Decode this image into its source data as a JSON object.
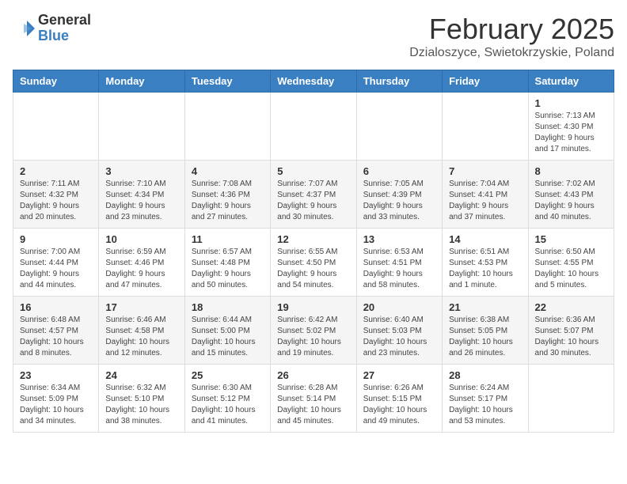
{
  "header": {
    "logo": {
      "general": "General",
      "blue": "Blue"
    },
    "title": "February 2025",
    "subtitle": "Dzialoszyce, Swietokrzyskie, Poland"
  },
  "weekdays": [
    "Sunday",
    "Monday",
    "Tuesday",
    "Wednesday",
    "Thursday",
    "Friday",
    "Saturday"
  ],
  "weeks": [
    [
      {
        "day": "",
        "info": ""
      },
      {
        "day": "",
        "info": ""
      },
      {
        "day": "",
        "info": ""
      },
      {
        "day": "",
        "info": ""
      },
      {
        "day": "",
        "info": ""
      },
      {
        "day": "",
        "info": ""
      },
      {
        "day": "1",
        "info": "Sunrise: 7:13 AM\nSunset: 4:30 PM\nDaylight: 9 hours and 17 minutes."
      }
    ],
    [
      {
        "day": "2",
        "info": "Sunrise: 7:11 AM\nSunset: 4:32 PM\nDaylight: 9 hours and 20 minutes."
      },
      {
        "day": "3",
        "info": "Sunrise: 7:10 AM\nSunset: 4:34 PM\nDaylight: 9 hours and 23 minutes."
      },
      {
        "day": "4",
        "info": "Sunrise: 7:08 AM\nSunset: 4:36 PM\nDaylight: 9 hours and 27 minutes."
      },
      {
        "day": "5",
        "info": "Sunrise: 7:07 AM\nSunset: 4:37 PM\nDaylight: 9 hours and 30 minutes."
      },
      {
        "day": "6",
        "info": "Sunrise: 7:05 AM\nSunset: 4:39 PM\nDaylight: 9 hours and 33 minutes."
      },
      {
        "day": "7",
        "info": "Sunrise: 7:04 AM\nSunset: 4:41 PM\nDaylight: 9 hours and 37 minutes."
      },
      {
        "day": "8",
        "info": "Sunrise: 7:02 AM\nSunset: 4:43 PM\nDaylight: 9 hours and 40 minutes."
      }
    ],
    [
      {
        "day": "9",
        "info": "Sunrise: 7:00 AM\nSunset: 4:44 PM\nDaylight: 9 hours and 44 minutes."
      },
      {
        "day": "10",
        "info": "Sunrise: 6:59 AM\nSunset: 4:46 PM\nDaylight: 9 hours and 47 minutes."
      },
      {
        "day": "11",
        "info": "Sunrise: 6:57 AM\nSunset: 4:48 PM\nDaylight: 9 hours and 50 minutes."
      },
      {
        "day": "12",
        "info": "Sunrise: 6:55 AM\nSunset: 4:50 PM\nDaylight: 9 hours and 54 minutes."
      },
      {
        "day": "13",
        "info": "Sunrise: 6:53 AM\nSunset: 4:51 PM\nDaylight: 9 hours and 58 minutes."
      },
      {
        "day": "14",
        "info": "Sunrise: 6:51 AM\nSunset: 4:53 PM\nDaylight: 10 hours and 1 minute."
      },
      {
        "day": "15",
        "info": "Sunrise: 6:50 AM\nSunset: 4:55 PM\nDaylight: 10 hours and 5 minutes."
      }
    ],
    [
      {
        "day": "16",
        "info": "Sunrise: 6:48 AM\nSunset: 4:57 PM\nDaylight: 10 hours and 8 minutes."
      },
      {
        "day": "17",
        "info": "Sunrise: 6:46 AM\nSunset: 4:58 PM\nDaylight: 10 hours and 12 minutes."
      },
      {
        "day": "18",
        "info": "Sunrise: 6:44 AM\nSunset: 5:00 PM\nDaylight: 10 hours and 15 minutes."
      },
      {
        "day": "19",
        "info": "Sunrise: 6:42 AM\nSunset: 5:02 PM\nDaylight: 10 hours and 19 minutes."
      },
      {
        "day": "20",
        "info": "Sunrise: 6:40 AM\nSunset: 5:03 PM\nDaylight: 10 hours and 23 minutes."
      },
      {
        "day": "21",
        "info": "Sunrise: 6:38 AM\nSunset: 5:05 PM\nDaylight: 10 hours and 26 minutes."
      },
      {
        "day": "22",
        "info": "Sunrise: 6:36 AM\nSunset: 5:07 PM\nDaylight: 10 hours and 30 minutes."
      }
    ],
    [
      {
        "day": "23",
        "info": "Sunrise: 6:34 AM\nSunset: 5:09 PM\nDaylight: 10 hours and 34 minutes."
      },
      {
        "day": "24",
        "info": "Sunrise: 6:32 AM\nSunset: 5:10 PM\nDaylight: 10 hours and 38 minutes."
      },
      {
        "day": "25",
        "info": "Sunrise: 6:30 AM\nSunset: 5:12 PM\nDaylight: 10 hours and 41 minutes."
      },
      {
        "day": "26",
        "info": "Sunrise: 6:28 AM\nSunset: 5:14 PM\nDaylight: 10 hours and 45 minutes."
      },
      {
        "day": "27",
        "info": "Sunrise: 6:26 AM\nSunset: 5:15 PM\nDaylight: 10 hours and 49 minutes."
      },
      {
        "day": "28",
        "info": "Sunrise: 6:24 AM\nSunset: 5:17 PM\nDaylight: 10 hours and 53 minutes."
      },
      {
        "day": "",
        "info": ""
      }
    ]
  ]
}
